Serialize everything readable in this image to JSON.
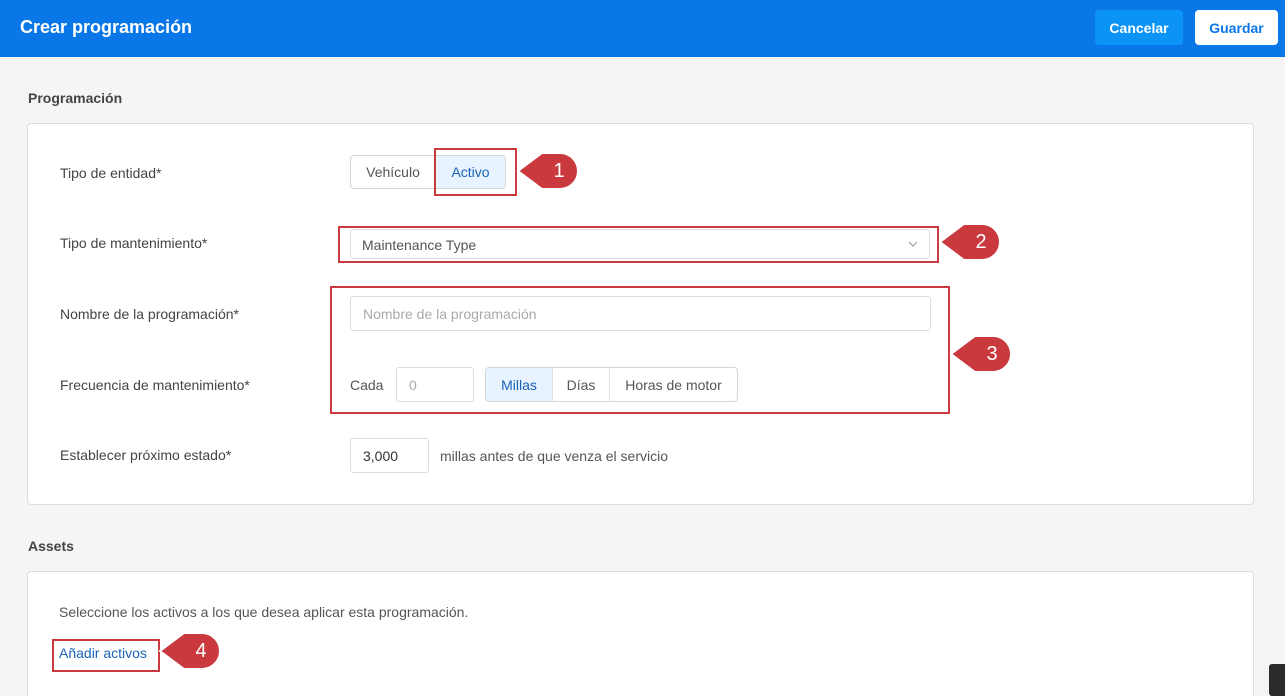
{
  "header": {
    "title": "Crear programación",
    "cancel_label": "Cancelar",
    "save_label": "Guardar"
  },
  "programacion": {
    "section_title": "Programación",
    "entity_type": {
      "label": "Tipo de entidad*",
      "options": [
        "Vehículo",
        "Activo"
      ],
      "selected": "Activo"
    },
    "maintenance_type": {
      "label": "Tipo de mantenimiento*",
      "value": "Maintenance Type"
    },
    "schedule_name": {
      "label": "Nombre de la programación*",
      "placeholder": "Nombre de la programación"
    },
    "frequency": {
      "label": "Frecuencia de mantenimiento*",
      "every_label": "Cada",
      "placeholder": "0",
      "units": [
        "Millas",
        "Días",
        "Horas de motor"
      ],
      "selected_unit": "Millas"
    },
    "next_state": {
      "label": "Establecer próximo estado*",
      "value": "3,000",
      "suffix": "millas antes de que venza el servicio"
    }
  },
  "assets": {
    "section_title": "Assets",
    "description": "Seleccione los activos a los que desea aplicar esta programación.",
    "add_link": "Añadir activos"
  },
  "callouts": [
    "1",
    "2",
    "3",
    "4"
  ],
  "colors": {
    "header_bg": "#0a77e8",
    "cancel_bg": "#0b93f5",
    "highlight": "#c9393d",
    "active_option_bg": "#e7f3fe",
    "link": "#1a63b5"
  }
}
